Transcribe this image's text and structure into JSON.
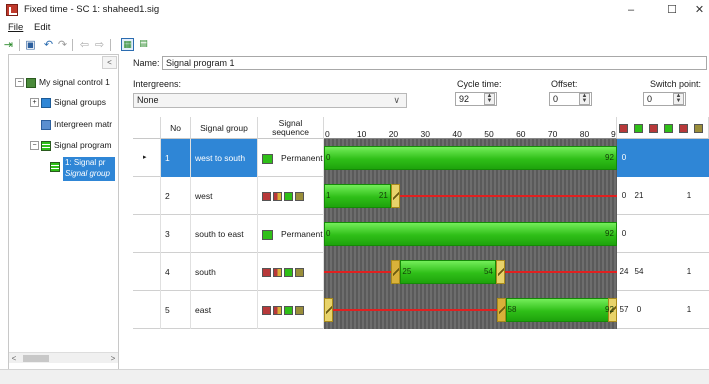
{
  "window": {
    "title": "Fixed time - SC 1: shaheed1.sig",
    "minimize": "–",
    "maximize": "☐",
    "close": "✕"
  },
  "menu": {
    "file": "File",
    "edit": "Edit"
  },
  "toolbar": {
    "icons": [
      "import-icon",
      "save-icon",
      "undo-icon",
      "redo-icon",
      "back-icon",
      "forward-icon",
      "layout-grid-icon",
      "layout-split-icon"
    ]
  },
  "tree": {
    "collapse_label": "<",
    "items": [
      {
        "label": "My signal control 1",
        "exp": "−"
      },
      {
        "label": "Signal groups",
        "exp": "+"
      },
      {
        "label": "Intergreen matr"
      },
      {
        "label": "Signal program",
        "exp": "−"
      }
    ],
    "selected_line1": "1: Signal pr",
    "selected_line2": "Signal group",
    "scroll_left": "<",
    "scroll_right": ">"
  },
  "form": {
    "name_label": "Name:",
    "name_value": "Signal program 1",
    "intergreens_label": "Intergreens:",
    "intergreens_value": "None",
    "cycle_label": "Cycle time:",
    "cycle_value": "92",
    "offset_label": "Offset:",
    "offset_value": "0",
    "switch_label": "Switch point:",
    "switch_value": "0"
  },
  "table": {
    "headers": {
      "no": "No",
      "group": "Signal group",
      "seq_1": "Signal",
      "seq_2": "sequence"
    },
    "ticks": [
      "0",
      "10",
      "20",
      "30",
      "40",
      "50",
      "60",
      "70",
      "80",
      "9"
    ],
    "header_icon_colors": [
      "#b7393a",
      "#2fbf18",
      "#b7393a",
      "#2fbf18",
      "#b7393a",
      "#9a8e3a"
    ],
    "cycle_length": 92,
    "rows": [
      {
        "marker": "▸",
        "no": "1",
        "name": "west to south",
        "permanent": "Permanent",
        "selected": true,
        "green_start": 0,
        "green_end": 92,
        "start_label": "0",
        "end_label": "92",
        "col_a": "0",
        "col_b": "",
        "col_c": ""
      },
      {
        "marker": "",
        "no": "2",
        "name": "west",
        "permanent": "",
        "selected": false,
        "green_start": 0,
        "green_end": 21,
        "start_label": "1",
        "end_label": "21",
        "col_a": "0",
        "col_b": "21",
        "col_c": "1"
      },
      {
        "marker": "",
        "no": "3",
        "name": "south to east",
        "permanent": "Permanent",
        "selected": false,
        "green_start": 0,
        "green_end": 92,
        "start_label": "0",
        "end_label": "92",
        "col_a": "0",
        "col_b": "",
        "col_c": ""
      },
      {
        "marker": "",
        "no": "4",
        "name": "south",
        "permanent": "",
        "selected": false,
        "green_start": 24,
        "green_end": 54,
        "start_label": "25",
        "end_label": "54",
        "col_a": "24",
        "col_b": "54",
        "col_c": "1"
      },
      {
        "marker": "",
        "no": "5",
        "name": "east",
        "permanent": "",
        "selected": false,
        "green_start": 57,
        "green_end": 92,
        "start_label": "58",
        "end_label": "92",
        "col_a": "57",
        "col_b": "0",
        "col_c": "1"
      }
    ]
  }
}
